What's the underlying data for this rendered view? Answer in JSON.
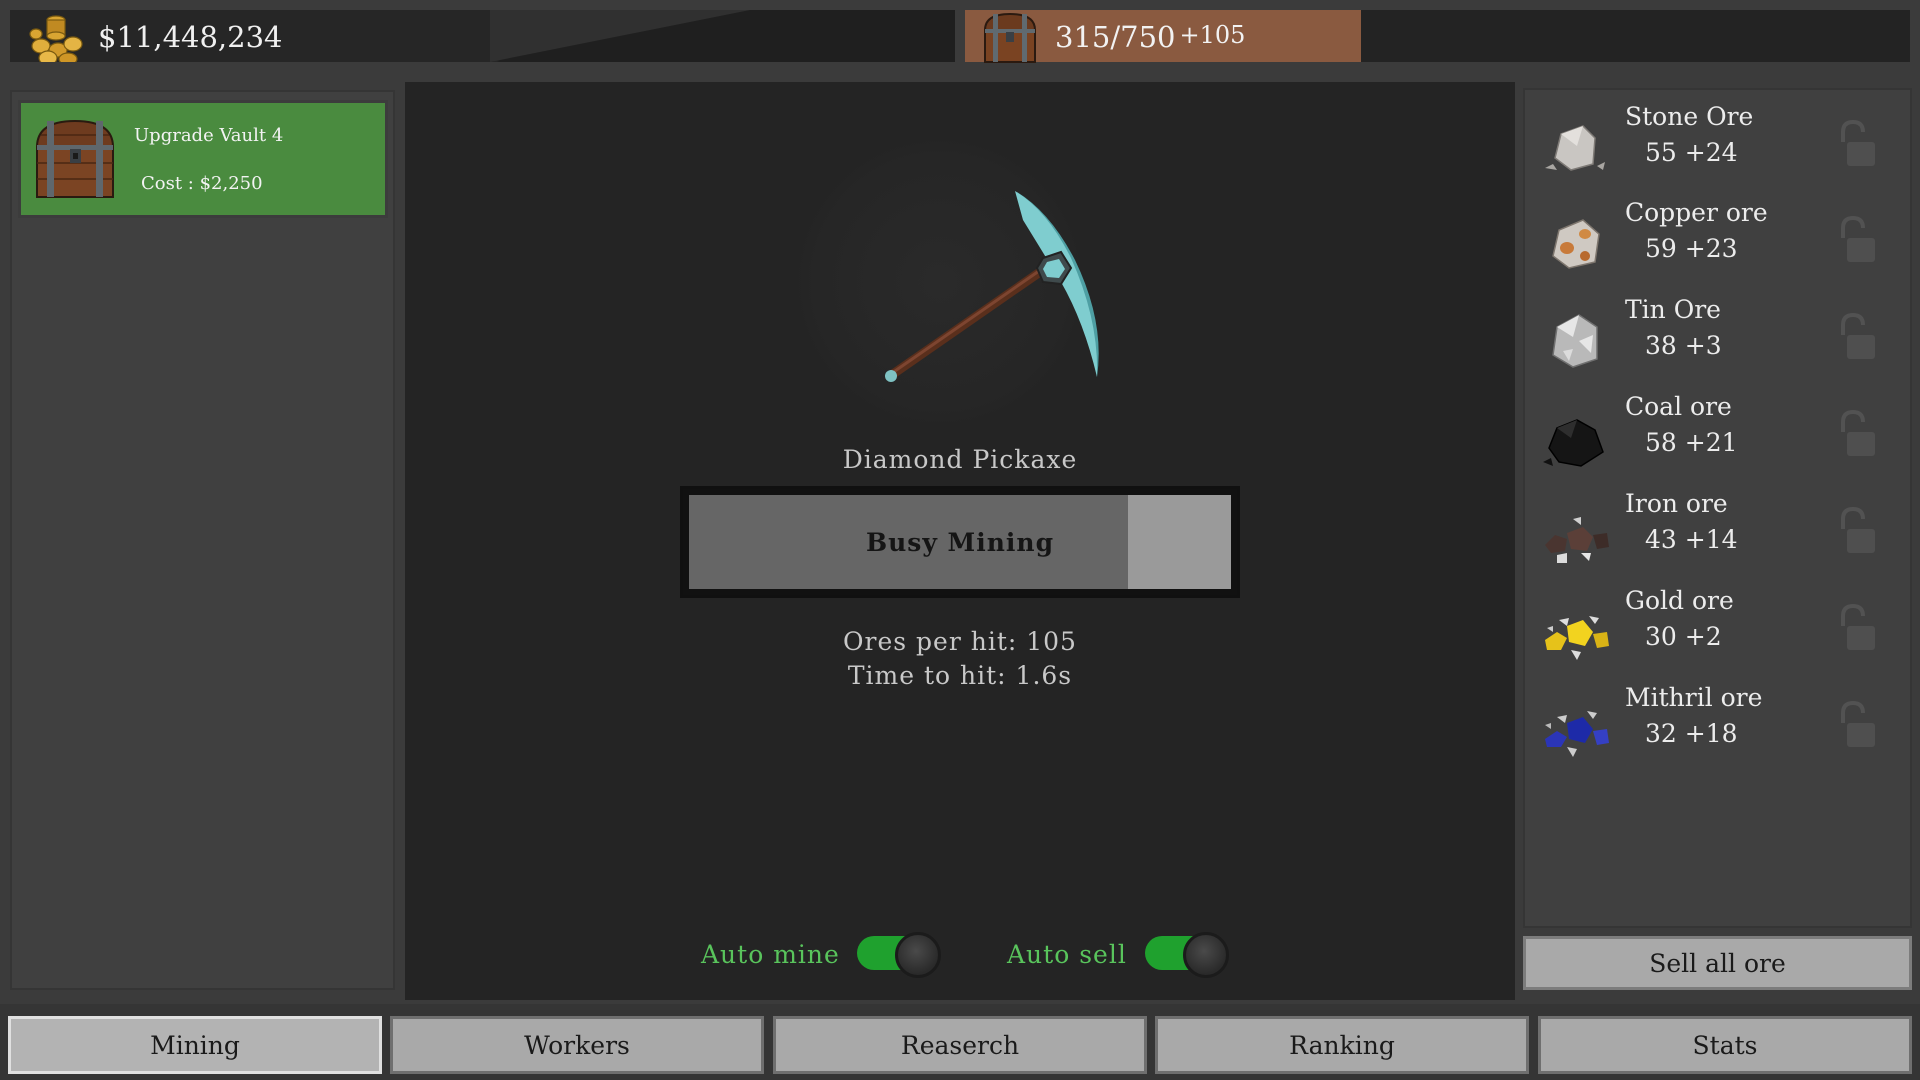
{
  "header": {
    "money": "$11,448,234",
    "vault_count": "315/750",
    "vault_plus": "+105"
  },
  "upgrade": {
    "title": "Upgrade Vault 4",
    "cost": "Cost : $2,250",
    "color": "#4a8b3f"
  },
  "mining": {
    "tool_name": "Diamond Pickaxe",
    "button_label": "Busy Mining",
    "progress": 0.81,
    "ores_per_hit": "Ores per hit: 105",
    "time_to_hit": "Time to hit: 1.6s",
    "auto_mine_label": "Auto mine",
    "auto_mine_on": true,
    "auto_sell_label": "Auto sell",
    "auto_sell_on": true,
    "toggle_color": "#1fa12e"
  },
  "ores": [
    {
      "name": "Stone Ore",
      "count": "55 +24",
      "icon": "stone-ore-icon"
    },
    {
      "name": "Copper ore",
      "count": "59 +23",
      "icon": "copper-ore-icon"
    },
    {
      "name": "Tin Ore",
      "count": "38 +3",
      "icon": "tin-ore-icon"
    },
    {
      "name": "Coal ore",
      "count": "58 +21",
      "icon": "coal-ore-icon"
    },
    {
      "name": "Iron ore",
      "count": "43 +14",
      "icon": "iron-ore-icon"
    },
    {
      "name": "Gold ore",
      "count": "30 +2",
      "icon": "gold-ore-icon"
    },
    {
      "name": "Mithril ore",
      "count": "32 +18",
      "icon": "mithril-ore-icon"
    }
  ],
  "sell_all_label": "Sell all ore",
  "nav": {
    "tabs": [
      {
        "label": "Mining",
        "active": true
      },
      {
        "label": "Workers",
        "active": false
      },
      {
        "label": "Reaserch",
        "active": false
      },
      {
        "label": "Ranking",
        "active": false
      },
      {
        "label": "Stats",
        "active": false
      }
    ]
  }
}
